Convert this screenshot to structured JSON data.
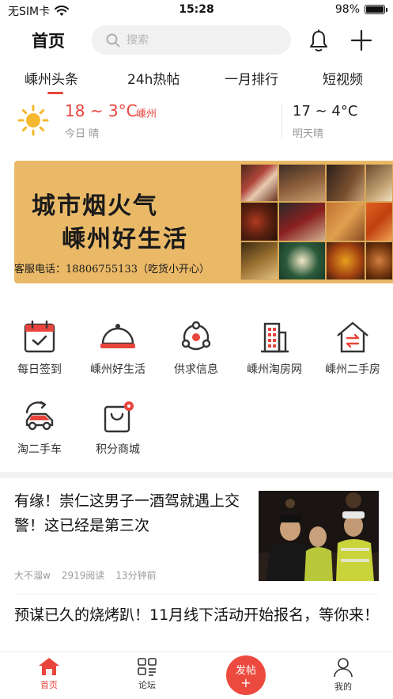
{
  "status_bar": {
    "carrier": "无SIM卡",
    "time": "15:28",
    "battery": "98%",
    "battery_level": 0.98
  },
  "header": {
    "title": "首页",
    "search_placeholder": "搜索",
    "icons": [
      "search-icon",
      "bell-icon",
      "plus-icon"
    ]
  },
  "tabs": [
    {
      "label": "嵊州头条",
      "active": true
    },
    {
      "label": "24h热帖",
      "active": false
    },
    {
      "label": "一月排行",
      "active": false
    },
    {
      "label": "短视频",
      "active": false
    }
  ],
  "weather": {
    "today_temp": "18 ~ 3°C",
    "city": "嵊州",
    "today_label": "今日 晴",
    "tomorrow_temp": "17 ~ 4°C",
    "tomorrow_label": "明天晴"
  },
  "banner": {
    "line1": "城市烟火气",
    "line2": "嵊州好生活",
    "phone": "客服电话：18806755133（吃货小开心）"
  },
  "quick_links": [
    {
      "label": "每日签到",
      "icon": "calendar-check-icon"
    },
    {
      "label": "嵊州好生活",
      "icon": "dish-cover-icon"
    },
    {
      "label": "供求信息",
      "icon": "share-network-icon"
    },
    {
      "label": "嵊州淘房网",
      "icon": "building-icon"
    },
    {
      "label": "嵊州二手房",
      "icon": "house-exchange-icon"
    },
    {
      "label": "淘二手车",
      "icon": "car-refresh-icon"
    },
    {
      "label": "积分商城",
      "icon": "shopping-bag-icon"
    }
  ],
  "articles": [
    {
      "title": "有缘！崇仁这男子一酒驾就遇上交警！这已经是第三次",
      "author": "大不溜w",
      "reads": "2919阅读",
      "time": "13分钟前"
    },
    {
      "title": "预谋已久的烧烤趴！11月线下活动开始报名，等你来！"
    }
  ],
  "bottom_nav": {
    "home": "首页",
    "forum": "论坛",
    "post": "发帖",
    "post_plus": "+",
    "mine": "我的"
  },
  "colors": {
    "accent": "#e8453c",
    "banner_bg": "#eab968",
    "weather_sun": "#f5b82e"
  }
}
